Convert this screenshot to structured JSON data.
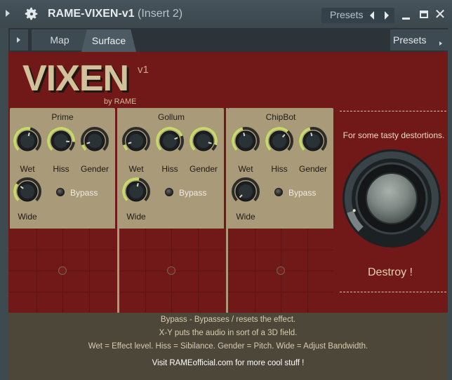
{
  "window": {
    "title": "RAME-VIXEN-v1",
    "insert": "(Insert 2)",
    "presets_label": "Presets"
  },
  "wrapper": {
    "tabs": [
      {
        "label": "Map",
        "active": false
      },
      {
        "label": "Surface",
        "active": true
      }
    ],
    "presets_label": "Presets"
  },
  "plugin": {
    "logo": "VIXEN",
    "version": "v1",
    "byline": "by RAME",
    "tagline": "For some tasty destortions.",
    "destroy_label": "Destroy !",
    "bypass_label": "Bypass",
    "modules": [
      {
        "name": "Prime",
        "knobs": [
          {
            "label": "Wet",
            "value": 0.55
          },
          {
            "label": "Hiss",
            "value": 0.85
          },
          {
            "label": "Gender",
            "value": 0.1
          },
          {
            "label": "Wide",
            "value": 0.3
          }
        ],
        "xy": [
          0.5,
          0.5
        ]
      },
      {
        "name": "Gollum",
        "knobs": [
          {
            "label": "Wet",
            "value": 0.1
          },
          {
            "label": "Hiss",
            "value": 0.75
          },
          {
            "label": "Gender",
            "value": 0.9
          },
          {
            "label": "Wide",
            "value": 0.55
          }
        ],
        "xy": [
          0.5,
          0.5
        ]
      },
      {
        "name": "ChipBot",
        "knobs": [
          {
            "label": "Wet",
            "value": 0.45
          },
          {
            "label": "Hiss",
            "value": 0.65
          },
          {
            "label": "Gender",
            "value": 0.45
          },
          {
            "label": "Wide",
            "value": 0.0
          }
        ],
        "xy": [
          0.5,
          0.5
        ]
      }
    ],
    "destroy_value": 0.1
  },
  "footer": {
    "line1": "Bypass - Bypasses / resets the effect.",
    "line2": "X-Y puts the audio in sort of a 3D field.",
    "line3": "Wet = Effect level. Hiss = Sibilance. Gender = Pitch. Wide = Adjust Bandwidth.",
    "line4": "Visit RAMEofficial.com for more cool stuff !"
  },
  "colors": {
    "surface": "#711818",
    "panel": "#a99a7a",
    "knob_arc": "#c6d96a",
    "footer": "#4d4739"
  },
  "icons": [
    "gear-icon",
    "chevron-right-icon",
    "chevron-left-icon",
    "minimize-icon",
    "maximize-icon",
    "close-icon"
  ]
}
